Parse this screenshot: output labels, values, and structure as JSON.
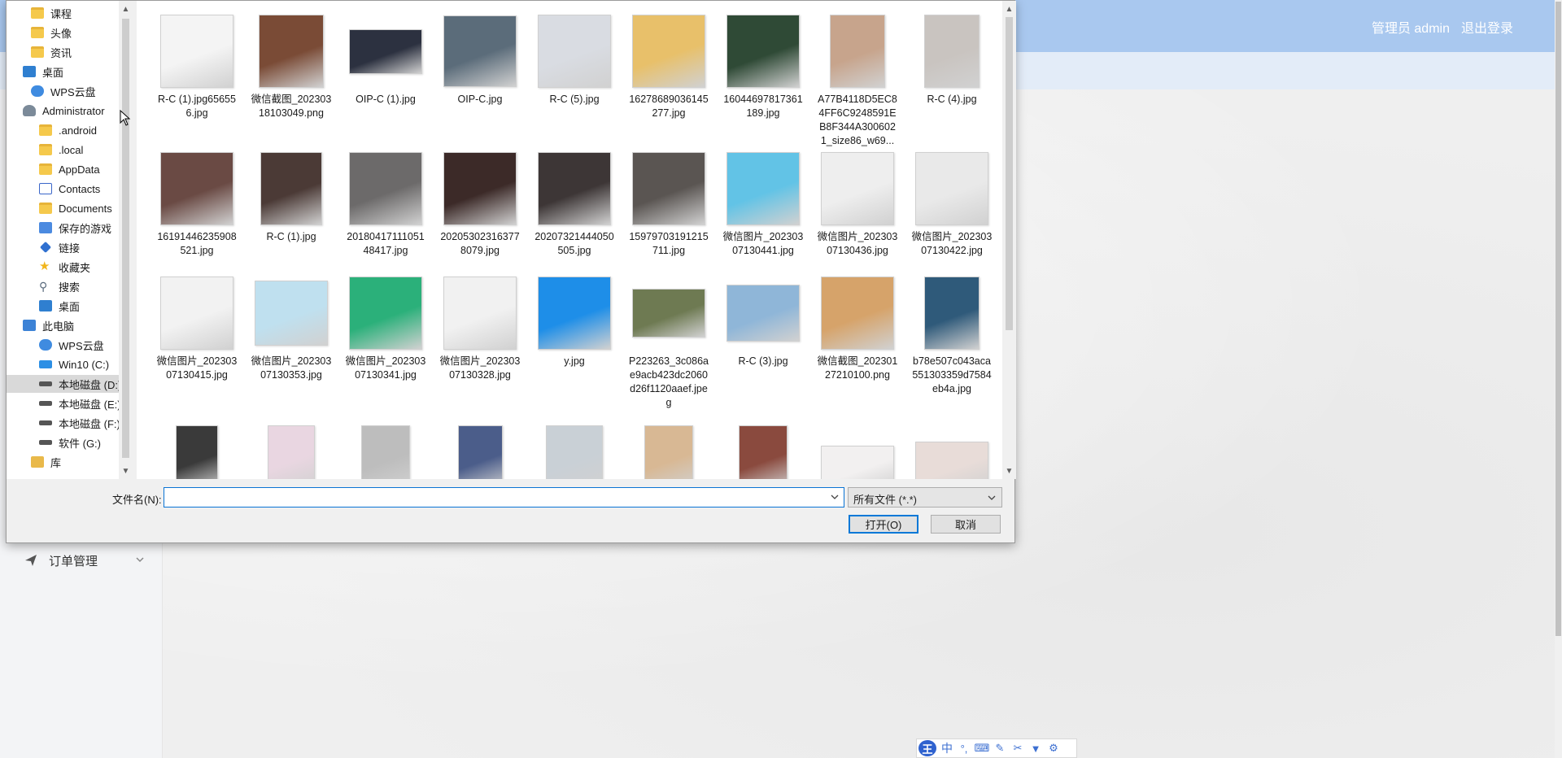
{
  "app": {
    "user_label": "管理员 admin",
    "logout_label": "退出登录",
    "menu_order": "订单管理"
  },
  "dialog": {
    "nav_items": [
      {
        "label": "课程",
        "icon": "folder-icon"
      },
      {
        "label": "头像",
        "icon": "folder-icon"
      },
      {
        "label": "资讯",
        "icon": "folder-icon"
      },
      {
        "label": "桌面",
        "icon": "desktop-icon"
      },
      {
        "label": "WPS云盘",
        "icon": "cloud-icon"
      },
      {
        "label": "Administrator",
        "icon": "user-icon"
      },
      {
        "label": ".android",
        "icon": "folder-icon"
      },
      {
        "label": ".local",
        "icon": "folder-icon"
      },
      {
        "label": "AppData",
        "icon": "folder-icon"
      },
      {
        "label": "Contacts",
        "icon": "contacts-icon"
      },
      {
        "label": "Documents",
        "icon": "folder-icon"
      },
      {
        "label": "保存的游戏",
        "icon": "game-icon"
      },
      {
        "label": "链接",
        "icon": "link-icon"
      },
      {
        "label": "收藏夹",
        "icon": "star-icon"
      },
      {
        "label": "搜索",
        "icon": "search-icon"
      },
      {
        "label": "桌面",
        "icon": "desktop-icon"
      },
      {
        "label": "此电脑",
        "icon": "computer-icon"
      },
      {
        "label": "WPS云盘",
        "icon": "cloud-icon"
      },
      {
        "label": "Win10 (C:)",
        "icon": "windows-drive-icon"
      },
      {
        "label": "本地磁盘 (D:)",
        "icon": "drive-icon"
      },
      {
        "label": "本地磁盘 (E:)",
        "icon": "drive-icon"
      },
      {
        "label": "本地磁盘 (F:)",
        "icon": "drive-icon"
      },
      {
        "label": "软件 (G:)",
        "icon": "drive-icon"
      },
      {
        "label": "库",
        "icon": "library-icon"
      }
    ],
    "selected_nav": "本地磁盘 (D:)",
    "files": [
      {
        "name": "R-C (1).jpg656556.jpg",
        "color": "#f4f4f4"
      },
      {
        "name": "微信截图_20230318103049.png",
        "color": "#7a4b36"
      },
      {
        "name": "OIP-C (1).jpg",
        "color": "#2c3140"
      },
      {
        "name": "OIP-C.jpg",
        "color": "#5b6c7a"
      },
      {
        "name": "R-C (5).jpg",
        "color": "#d9dce2"
      },
      {
        "name": "16278689036145277.jpg",
        "color": "#e8c06a"
      },
      {
        "name": "16044697817361189.jpg",
        "color": "#2f4a36"
      },
      {
        "name": "A77B4118D5EC84FF6C9248591EB8F344A3006021_size86_w69...",
        "color": "#c7a48c"
      },
      {
        "name": "R-C (4).jpg",
        "color": "#c9c4c0"
      },
      {
        "name": "16191446235908521.jpg",
        "color": "#6a4a44"
      },
      {
        "name": "R-C (1).jpg",
        "color": "#4b3a36"
      },
      {
        "name": "2018041711105148417.jpg",
        "color": "#6c6a6a"
      },
      {
        "name": "202053023163778079.jpg",
        "color": "#3c2a28"
      },
      {
        "name": "20207321444050505.jpg",
        "color": "#3d3636"
      },
      {
        "name": "15979703191215711.jpg",
        "color": "#5a5552"
      },
      {
        "name": "微信图片_20230307130441.jpg",
        "color": "#62c3e6"
      },
      {
        "name": "微信图片_20230307130436.jpg",
        "color": "#eeeeee"
      },
      {
        "name": "微信图片_20230307130422.jpg",
        "color": "#e9e9e9"
      },
      {
        "name": "微信图片_20230307130415.jpg",
        "color": "#f2f2f2"
      },
      {
        "name": "微信图片_20230307130353.jpg",
        "color": "#bfe0ef"
      },
      {
        "name": "微信图片_20230307130341.jpg",
        "color": "#2bb07a"
      },
      {
        "name": "微信图片_20230307130328.jpg",
        "color": "#f1f1f1"
      },
      {
        "name": "y.jpg",
        "color": "#1e8ee8"
      },
      {
        "name": "P223263_3c086ae9acb423dc2060d26f1120aaef.jpeg",
        "color": "#6e7a52"
      },
      {
        "name": "R-C (3).jpg",
        "color": "#8fb6d8"
      },
      {
        "name": "微信截图_20230127210100.png",
        "color": "#d6a36a"
      },
      {
        "name": "b78e507c043aca551303359d7584eb4a.jpg",
        "color": "#2f5a7a"
      },
      {
        "name": "",
        "color": "#3a3a3a"
      },
      {
        "name": "",
        "color": "#e9d6e1"
      },
      {
        "name": "",
        "color": "#bdbdbd"
      },
      {
        "name": "",
        "color": "#4b5d8a"
      },
      {
        "name": "",
        "color": "#c9d0d6"
      },
      {
        "name": "",
        "color": "#d8b894"
      },
      {
        "name": "",
        "color": "#8a4a3e"
      },
      {
        "name": "",
        "color": "#f2f0f0"
      },
      {
        "name": "",
        "color": "#e8dcd8"
      }
    ],
    "filename_label": "文件名(N):",
    "filename_value": "",
    "filetype_value": "所有文件 (*.*)",
    "open_label": "打开(O)",
    "cancel_label": "取消"
  },
  "ime": {
    "logo": "王",
    "mode": "中"
  }
}
